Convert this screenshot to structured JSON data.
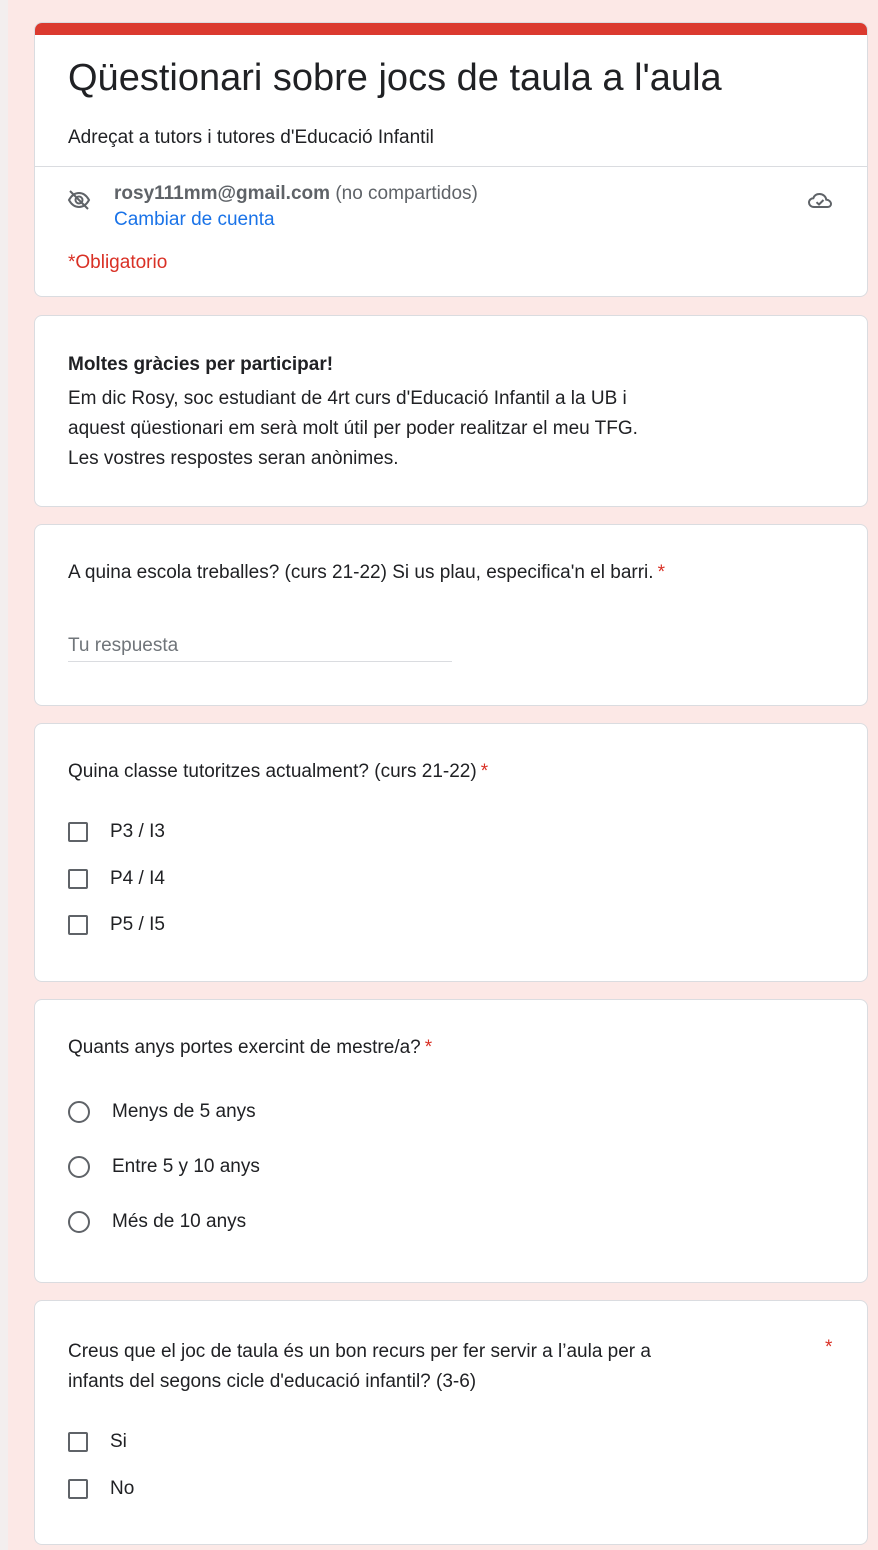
{
  "form": {
    "title": "Qüestionari sobre jocs de taula a l'aula",
    "subtitle": "Adreçat a tutors i tutores d'Educació Infantil",
    "accent_color": "#db3a2f"
  },
  "account": {
    "icon": "eye-off-icon",
    "email": "rosy111mm@gmail.com",
    "sharing_note": "(no compartidos)",
    "switch_label": "Cambiar de cuenta",
    "save_icon": "cloud-saved-icon"
  },
  "required_note": "*Obligatorio",
  "intro": {
    "heading": "Moltes gràcies per participar!",
    "lines": [
      "Em dic Rosy, soc estudiant de 4rt curs d'Educació Infantil a la UB i",
      "aquest qüestionari em serà molt útil per poder realitzar el meu TFG.",
      "Les vostres respostes seran anònimes."
    ]
  },
  "questions": [
    {
      "title": "A quina escola treballes? (curs 21-22) Si us plau, especifica'n el barri.",
      "required_mark": "*",
      "type": "short-text",
      "placeholder": "Tu respuesta",
      "value": ""
    },
    {
      "title": "Quina classe tutoritzes actualment? (curs 21-22)",
      "required_mark": "*",
      "type": "checkbox",
      "options": [
        "P3 / I3",
        "P4 / I4",
        "P5 / I5"
      ]
    },
    {
      "title": "Quants anys portes exercint de mestre/a?",
      "required_mark": "*",
      "type": "radio",
      "options": [
        "Menys de 5 anys",
        "Entre 5 y 10 anys",
        "Més de 10 anys"
      ]
    },
    {
      "title_lines": [
        "Creus que el joc de taula és un bon recurs per fer servir a l’aula  per a",
        "infants del segons cicle d'educació infantil? (3-6)"
      ],
      "required_mark": "*",
      "type": "checkbox",
      "options": [
        "Si",
        "No"
      ]
    }
  ]
}
